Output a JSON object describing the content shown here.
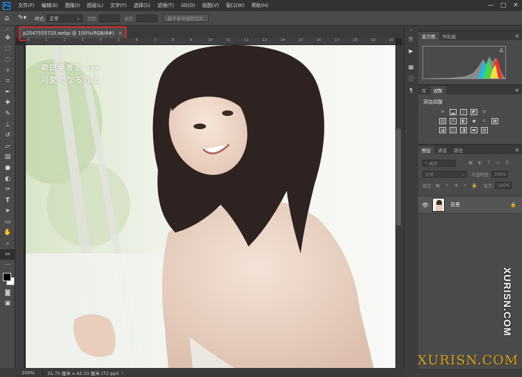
{
  "app": {
    "logo": "Ps"
  },
  "menu": {
    "items": [
      "文件(F)",
      "编辑(E)",
      "图像(I)",
      "图层(L)",
      "文字(Y)",
      "选择(S)",
      "滤镜(T)",
      "3D(D)",
      "视图(V)",
      "窗口(W)",
      "帮助(H)"
    ]
  },
  "window_controls": {
    "minimize": "—",
    "restore": "□",
    "close": "✕"
  },
  "options_bar": {
    "style_label": "样式:",
    "style_value": "正常",
    "width_label": "宽度:",
    "height_label": "高度:",
    "slices_button": "基于参考线的切片"
  },
  "document": {
    "tab_title": "p2547555720.webp @ 100%(RGB/8#)",
    "tab_close": "×",
    "ruler_ticks": [
      "0",
      "1",
      "2",
      "3",
      "4",
      "5",
      "6",
      "7",
      "8",
      "9",
      "10",
      "11",
      "12",
      "13",
      "14",
      "15",
      "16",
      "17",
      "18",
      "19",
      "20"
    ]
  },
  "photo_text": {
    "name_line": "朝田亜香里",
    "name_small": "写真集",
    "tagline": "可愛くなる方法"
  },
  "watermark": {
    "vertical": "XURISN.COM",
    "horizontal": "XURISN.COM"
  },
  "status": {
    "zoom": "100%",
    "info": "31.75 厘米 x 42.33 厘米 (72 ppi)"
  },
  "panels": {
    "histogram_tabs": [
      "直方图",
      "导航器"
    ],
    "adjust_tabs": [
      "库",
      "调整"
    ],
    "adjust_title": "添加调整",
    "layers_tabs": [
      "图层",
      "通道",
      "路径"
    ],
    "layers": {
      "filter_kind": "类型",
      "blend_mode": "正常",
      "opacity_label": "不透明度:",
      "opacity_value": "100%",
      "lock_label": "锁定:",
      "fill_label": "填充:",
      "fill_value": "100%",
      "layer_name": "背景"
    }
  },
  "colors": {
    "accent_red": "#d52b2b",
    "panel_bg": "#4a4a4a",
    "menubar_bg": "#323232"
  }
}
